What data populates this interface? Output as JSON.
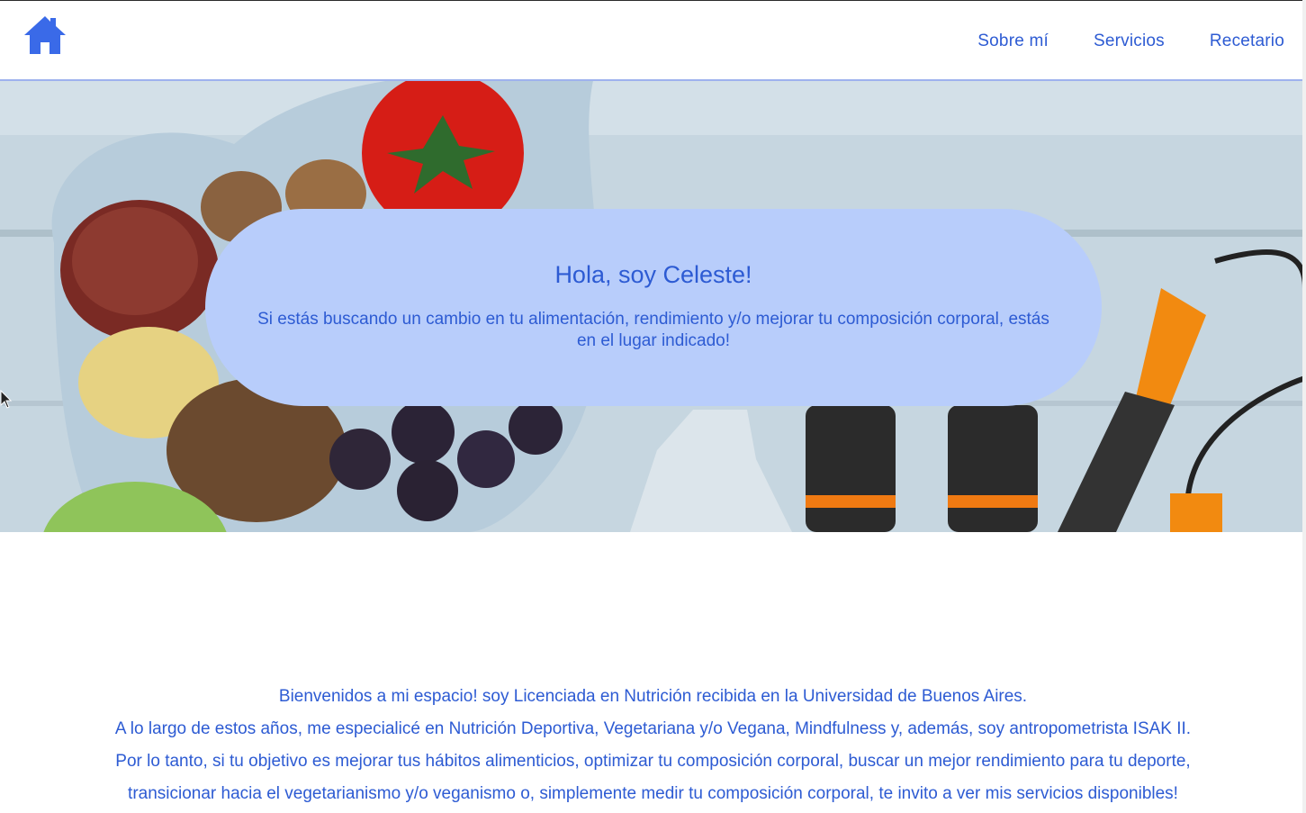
{
  "header": {
    "home_icon": "home-icon",
    "nav": [
      {
        "label": "Sobre mí"
      },
      {
        "label": "Servicios"
      },
      {
        "label": "Recetario"
      }
    ]
  },
  "hero": {
    "title": "Hola, soy Celeste!",
    "subtitle": "Si estás buscando un cambio en tu alimentación, rendimiento y/o mejorar tu composición corporal, estás en el lugar indicado!"
  },
  "intro": {
    "lines": [
      "Bienvenidos a mi espacio! soy Licenciada en Nutrición recibida en la Universidad de Buenos Aires.",
      "A lo largo de estos años, me especialicé en Nutrición Deportiva, Vegetariana y/o Vegana, Mindfulness y, además, soy antropometrista ISAK II.",
      "Por lo tanto, si tu objetivo es mejorar tus hábitos alimenticios, optimizar tu composición corporal, buscar un mejor rendimiento para tu deporte,",
      "transicionar hacia el vegetarianismo y/o veganismo o, simplemente medir tu composición corporal, te invito a ver mis servicios disponibles!"
    ]
  },
  "colors": {
    "accent": "#2d5bd3",
    "card": "#b8cdfb",
    "rule": "#9eb2ee"
  }
}
